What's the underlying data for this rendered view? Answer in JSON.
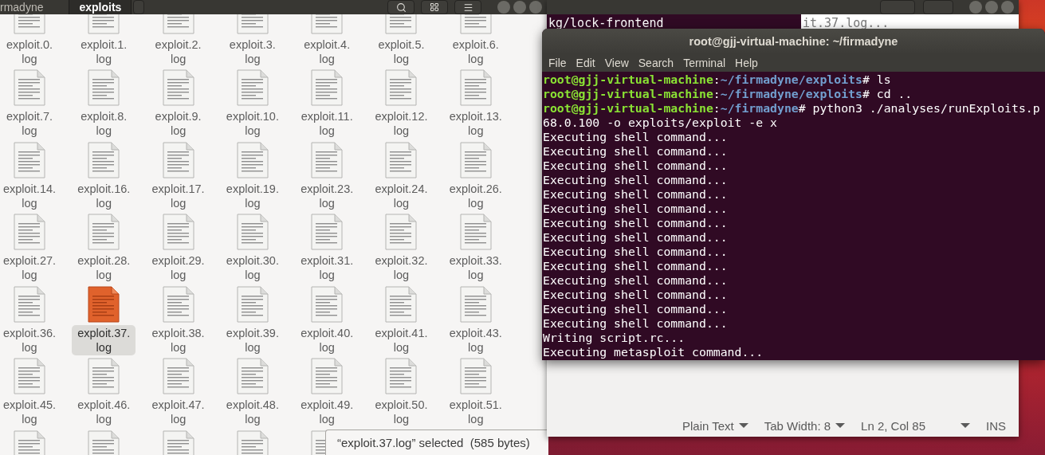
{
  "file_manager": {
    "path": [
      {
        "label": "rmadyne",
        "selected": false
      },
      {
        "label": "exploits",
        "selected": true
      }
    ],
    "files": [
      {
        "lines": [
          "exploit.0.",
          "log"
        ],
        "selected": false
      },
      {
        "lines": [
          "exploit.1.",
          "log"
        ],
        "selected": false
      },
      {
        "lines": [
          "exploit.2.",
          "log"
        ],
        "selected": false
      },
      {
        "lines": [
          "exploit.3.",
          "log"
        ],
        "selected": false
      },
      {
        "lines": [
          "exploit.4.",
          "log"
        ],
        "selected": false
      },
      {
        "lines": [
          "exploit.5.",
          "log"
        ],
        "selected": false
      },
      {
        "lines": [
          "exploit.6.",
          "log"
        ],
        "selected": false
      },
      {
        "lines": [
          "exploit.7.",
          "log"
        ],
        "selected": false
      },
      {
        "lines": [
          "exploit.8.",
          "log"
        ],
        "selected": false
      },
      {
        "lines": [
          "exploit.9.",
          "log"
        ],
        "selected": false
      },
      {
        "lines": [
          "exploit.10.",
          "log"
        ],
        "selected": false
      },
      {
        "lines": [
          "exploit.11.",
          "log"
        ],
        "selected": false
      },
      {
        "lines": [
          "exploit.12.",
          "log"
        ],
        "selected": false
      },
      {
        "lines": [
          "exploit.13.",
          "log"
        ],
        "selected": false
      },
      {
        "lines": [
          "exploit.14.",
          "log"
        ],
        "selected": false
      },
      {
        "lines": [
          "exploit.16.",
          "log"
        ],
        "selected": false
      },
      {
        "lines": [
          "exploit.17.",
          "log"
        ],
        "selected": false
      },
      {
        "lines": [
          "exploit.19.",
          "log"
        ],
        "selected": false
      },
      {
        "lines": [
          "exploit.23.",
          "log"
        ],
        "selected": false
      },
      {
        "lines": [
          "exploit.24.",
          "log"
        ],
        "selected": false
      },
      {
        "lines": [
          "exploit.26.",
          "log"
        ],
        "selected": false
      },
      {
        "lines": [
          "exploit.27.",
          "log"
        ],
        "selected": false
      },
      {
        "lines": [
          "exploit.28.",
          "log"
        ],
        "selected": false
      },
      {
        "lines": [
          "exploit.29.",
          "log"
        ],
        "selected": false
      },
      {
        "lines": [
          "exploit.30.",
          "log"
        ],
        "selected": false
      },
      {
        "lines": [
          "exploit.31.",
          "log"
        ],
        "selected": false
      },
      {
        "lines": [
          "exploit.32.",
          "log"
        ],
        "selected": false
      },
      {
        "lines": [
          "exploit.33.",
          "log"
        ],
        "selected": false
      },
      {
        "lines": [
          "exploit.36.",
          "log"
        ],
        "selected": false
      },
      {
        "lines": [
          "exploit.37.",
          "log"
        ],
        "selected": true
      },
      {
        "lines": [
          "exploit.38.",
          "log"
        ],
        "selected": false
      },
      {
        "lines": [
          "exploit.39.",
          "log"
        ],
        "selected": false
      },
      {
        "lines": [
          "exploit.40.",
          "log"
        ],
        "selected": false
      },
      {
        "lines": [
          "exploit.41.",
          "log"
        ],
        "selected": false
      },
      {
        "lines": [
          "exploit.43.",
          "log"
        ],
        "selected": false
      },
      {
        "lines": [
          "exploit.45.",
          "log"
        ],
        "selected": false
      },
      {
        "lines": [
          "exploit.46.",
          "log"
        ],
        "selected": false
      },
      {
        "lines": [
          "exploit.47.",
          "log"
        ],
        "selected": false
      },
      {
        "lines": [
          "exploit.48.",
          "log"
        ],
        "selected": false
      },
      {
        "lines": [
          "exploit.49.",
          "log"
        ],
        "selected": false
      },
      {
        "lines": [
          "exploit.50.",
          "log"
        ],
        "selected": false
      },
      {
        "lines": [
          "exploit.51.",
          "log"
        ],
        "selected": false
      }
    ],
    "status": "“exploit.37.log” selected  (585 bytes)"
  },
  "background_terminal": {
    "line": "kg/lock-frontend"
  },
  "text_editor": {
    "line": "it.37.log...",
    "status_items": [
      {
        "label": "Plain Text",
        "dropdown": true
      },
      {
        "label": "Tab Width: 8",
        "dropdown": true
      },
      {
        "label": "Ln 2, Col 85",
        "dropdown": true
      },
      {
        "label": "INS",
        "dropdown": false
      }
    ]
  },
  "terminal": {
    "title": "root@gjj-virtual-machine: ~/firmadyne",
    "menu": [
      "File",
      "Edit",
      "View",
      "Search",
      "Terminal",
      "Help"
    ],
    "lines": [
      {
        "segments": [
          {
            "kind": "user",
            "text": "root@gjj-virtual-machine"
          },
          {
            "kind": "plain",
            "text": ":"
          },
          {
            "kind": "path",
            "text": "~/firmadyne/exploits"
          },
          {
            "kind": "plain",
            "text": "# ls"
          }
        ]
      },
      {
        "segments": [
          {
            "kind": "user",
            "text": "root@gjj-virtual-machine"
          },
          {
            "kind": "plain",
            "text": ":"
          },
          {
            "kind": "path",
            "text": "~/firmadyne/exploits"
          },
          {
            "kind": "plain",
            "text": "# cd .."
          }
        ]
      },
      {
        "segments": [
          {
            "kind": "user",
            "text": "root@gjj-virtual-machine"
          },
          {
            "kind": "plain",
            "text": ":"
          },
          {
            "kind": "path",
            "text": "~/firmadyne"
          },
          {
            "kind": "plain",
            "text": "# python3 ./analyses/runExploits.p"
          }
        ]
      },
      {
        "segments": [
          {
            "kind": "plain",
            "text": "68.0.100 -o exploits/exploit -e x"
          }
        ]
      },
      {
        "segments": [
          {
            "kind": "plain",
            "text": "Executing shell command..."
          }
        ]
      },
      {
        "segments": [
          {
            "kind": "plain",
            "text": "Executing shell command..."
          }
        ]
      },
      {
        "segments": [
          {
            "kind": "plain",
            "text": "Executing shell command..."
          }
        ]
      },
      {
        "segments": [
          {
            "kind": "plain",
            "text": "Executing shell command..."
          }
        ]
      },
      {
        "segments": [
          {
            "kind": "plain",
            "text": "Executing shell command..."
          }
        ]
      },
      {
        "segments": [
          {
            "kind": "plain",
            "text": "Executing shell command..."
          }
        ]
      },
      {
        "segments": [
          {
            "kind": "plain",
            "text": "Executing shell command..."
          }
        ]
      },
      {
        "segments": [
          {
            "kind": "plain",
            "text": "Executing shell command..."
          }
        ]
      },
      {
        "segments": [
          {
            "kind": "plain",
            "text": "Executing shell command..."
          }
        ]
      },
      {
        "segments": [
          {
            "kind": "plain",
            "text": "Executing shell command..."
          }
        ]
      },
      {
        "segments": [
          {
            "kind": "plain",
            "text": "Executing shell command..."
          }
        ]
      },
      {
        "segments": [
          {
            "kind": "plain",
            "text": "Executing shell command..."
          }
        ]
      },
      {
        "segments": [
          {
            "kind": "plain",
            "text": "Executing shell command..."
          }
        ]
      },
      {
        "segments": [
          {
            "kind": "plain",
            "text": "Executing shell command..."
          }
        ]
      },
      {
        "segments": [
          {
            "kind": "plain",
            "text": "Writing script.rc..."
          }
        ]
      },
      {
        "segments": [
          {
            "kind": "plain",
            "text": "Executing metasploit command..."
          }
        ]
      }
    ]
  }
}
